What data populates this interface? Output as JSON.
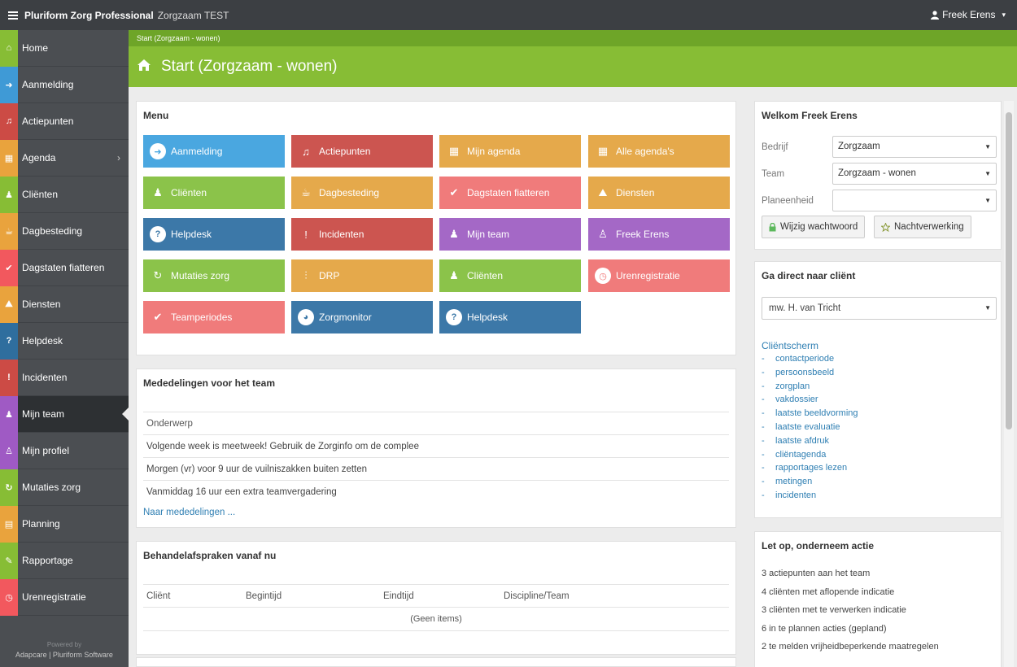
{
  "topbar": {
    "app_name": "Pluriform Zorg Professional",
    "environment": "Zorgzaam TEST",
    "user_name": "Freek Erens",
    "user_caret": "▾"
  },
  "sidebar": {
    "items": [
      {
        "label": "Home",
        "color": "#87bd35",
        "icon": "home-icon"
      },
      {
        "label": "Aanmelding",
        "color": "#3f9ad6",
        "icon": "arrow-right-circle-icon"
      },
      {
        "label": "Actiepunten",
        "color": "#cc4b45",
        "icon": "bell-icon"
      },
      {
        "label": "Agenda",
        "color": "#e9a33d",
        "icon": "calendar-icon",
        "chevron": "›"
      },
      {
        "label": "Cliënten",
        "color": "#87bd35",
        "icon": "users-icon"
      },
      {
        "label": "Dagbesteding",
        "color": "#e9a33d",
        "icon": "coffee-icon"
      },
      {
        "label": "Dagstaten fiatteren",
        "color": "#f2585e",
        "icon": "check-square-icon"
      },
      {
        "label": "Diensten",
        "color": "#e9a33d",
        "icon": "road-icon"
      },
      {
        "label": "Helpdesk",
        "color": "#2f6e9e",
        "icon": "question-icon"
      },
      {
        "label": "Incidenten",
        "color": "#cc4b45",
        "icon": "warning-icon"
      },
      {
        "label": "Mijn team",
        "color": "#9f5ac4",
        "icon": "team-icon"
      },
      {
        "label": "Mijn profiel",
        "color": "#9f5ac4",
        "icon": "user-icon"
      },
      {
        "label": "Mutaties zorg",
        "color": "#87bd35",
        "icon": "refresh-icon"
      },
      {
        "label": "Planning",
        "color": "#e9a33d",
        "icon": "truck-icon"
      },
      {
        "label": "Rapportage",
        "color": "#87bd35",
        "icon": "pencil-icon"
      },
      {
        "label": "Urenregistratie",
        "color": "#f2585e",
        "icon": "clock-icon"
      }
    ],
    "footer_powered": "Powered by",
    "footer_credit": "Adapcare | Pluriform Software"
  },
  "breadcrumb": "Start (Zorgzaam - wonen)",
  "page_title": "Start (Zorgzaam - wonen)",
  "menu": {
    "title": "Menu",
    "tiles": [
      {
        "label": "Aanmelding",
        "color": "#4aa7e0",
        "icon": "arrow-right-circle-icon"
      },
      {
        "label": "Actiepunten",
        "color": "#cc5550",
        "icon": "bell-icon"
      },
      {
        "label": "Mijn agenda",
        "color": "#e5a94b",
        "icon": "calendar-icon"
      },
      {
        "label": "Alle agenda's",
        "color": "#e5a94b",
        "icon": "calendar-icon"
      },
      {
        "label": "Cliënten",
        "color": "#8bc34a",
        "icon": "users-icon"
      },
      {
        "label": "Dagbesteding",
        "color": "#e5a94b",
        "icon": "coffee-icon"
      },
      {
        "label": "Dagstaten fiatteren",
        "color": "#f07b7b",
        "icon": "check-square-icon"
      },
      {
        "label": "Diensten",
        "color": "#e5a94b",
        "icon": "road-icon"
      },
      {
        "label": "Helpdesk",
        "color": "#3c78a8",
        "icon": "question-icon"
      },
      {
        "label": "Incidenten",
        "color": "#cc5550",
        "icon": "warning-icon"
      },
      {
        "label": "Mijn team",
        "color": "#a468c6",
        "icon": "team-icon"
      },
      {
        "label": "Freek Erens",
        "color": "#a468c6",
        "icon": "user-icon"
      },
      {
        "label": "Mutaties zorg",
        "color": "#8bc34a",
        "icon": "refresh-icon"
      },
      {
        "label": "DRP",
        "color": "#e5a94b",
        "icon": "sliders-icon"
      },
      {
        "label": "Cliënten",
        "color": "#8bc34a",
        "icon": "users-icon"
      },
      {
        "label": "Urenregistratie",
        "color": "#f07b7b",
        "icon": "clock-icon"
      },
      {
        "label": "Teamperiodes",
        "color": "#f07b7b",
        "icon": "check-icon"
      },
      {
        "label": "Zorgmonitor",
        "color": "#3c78a8",
        "icon": "dashboard-icon"
      },
      {
        "label": "Helpdesk",
        "color": "#3c78a8",
        "icon": "question-icon"
      }
    ]
  },
  "news": {
    "title": "Mededelingen voor het team",
    "column": "Onderwerp",
    "rows": [
      "Volgende week is meetweek! Gebruik de Zorginfo om de complee",
      "Morgen (vr) voor 9 uur de vuilniszakken buiten zetten",
      "Vanmiddag 16 uur een extra teamvergadering"
    ],
    "link": "Naar mededelingen ..."
  },
  "appointments": {
    "title": "Behandelafspraken vanaf nu",
    "columns": [
      "Cliënt",
      "Begintijd",
      "Eindtijd",
      "Discipline/Team"
    ],
    "empty": "(Geen items)"
  },
  "welcome": {
    "title": "Welkom Freek Erens",
    "fields": [
      {
        "label": "Bedrijf",
        "value": "Zorgzaam"
      },
      {
        "label": "Team",
        "value": "Zorgzaam - wonen"
      },
      {
        "label": "Planeenheid",
        "value": ""
      }
    ],
    "caret": "▼",
    "change_password": "Wijzig wachtwoord",
    "night_processing": "Nachtverwerking"
  },
  "client_nav": {
    "title": "Ga direct naar cliënt",
    "selected_client": "mw. H. van Tricht",
    "caret": "▼",
    "heading": "Cliëntscherm",
    "dash": "-",
    "links": [
      "contactperiode",
      "persoonsbeeld",
      "zorgplan",
      "vakdossier",
      "laatste beeldvorming",
      "laatste evaluatie",
      "laatste afdruk",
      "cliëntagenda",
      "rapportages lezen",
      "metingen",
      "incidenten"
    ]
  },
  "actions": {
    "title": "Let op, onderneem actie",
    "items": [
      "3 actiepunten aan het team",
      "4 cliënten met aflopende indicatie",
      "3 cliënten met te verwerken indicatie",
      "6 in te plannen acties (gepland)",
      "2 te melden vrijheidbeperkende maatregelen"
    ]
  }
}
